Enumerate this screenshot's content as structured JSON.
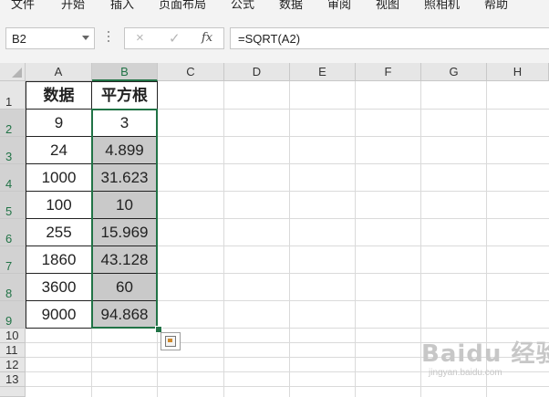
{
  "menu": [
    "文件",
    "开始",
    "插入",
    "页面布局",
    "公式",
    "数据",
    "审阅",
    "视图",
    "照相机",
    "帮助"
  ],
  "name_box": "B2",
  "formula_bar": {
    "cancel_icon": "×",
    "enter_icon": "✓",
    "fx_label": "fx",
    "formula": "=SQRT(A2)"
  },
  "columns": [
    "A",
    "B",
    "C",
    "D",
    "E",
    "F",
    "G",
    "H"
  ],
  "rows": [
    "1",
    "2",
    "3",
    "4",
    "5",
    "6",
    "7",
    "8",
    "9",
    "10",
    "11",
    "12",
    "13"
  ],
  "selected_column": "B",
  "table": {
    "headers": [
      "数据",
      "平方根"
    ],
    "data": [
      [
        "9",
        "3"
      ],
      [
        "24",
        "4.899"
      ],
      [
        "1000",
        "31.623"
      ],
      [
        "100",
        "10"
      ],
      [
        "255",
        "15.969"
      ],
      [
        "1860",
        "43.128"
      ],
      [
        "3600",
        "60"
      ],
      [
        "9000",
        "94.868"
      ]
    ]
  },
  "colors": {
    "accent": "#217346",
    "selected_fill": "#c9c9c9"
  },
  "watermark": {
    "main": "Baidu 经验",
    "sub": "jingyan.baidu.com"
  }
}
